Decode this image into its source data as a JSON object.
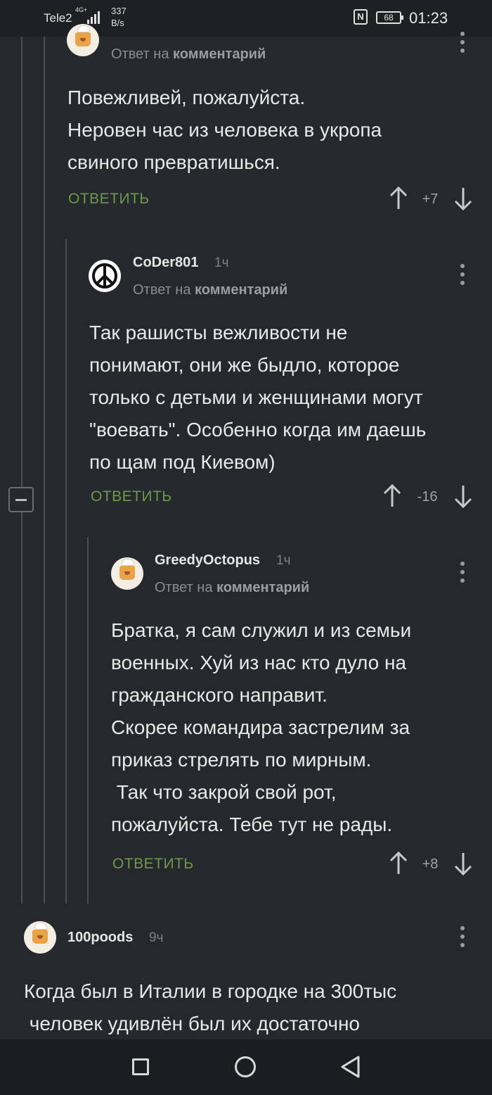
{
  "status_bar": {
    "carrier": "Tele2",
    "network": "4G+",
    "speed_value": "337",
    "speed_unit": "B/s",
    "nfc": "N",
    "battery": "68",
    "time": "01:23"
  },
  "comments": [
    {
      "username": "",
      "time": "",
      "reply_prefix": "Ответ на",
      "reply_target": "комментарий",
      "text": "Повежливей, пожалуйста.\nНеровен час из человека в укропа\nсвиного превратишься.",
      "reply_label": "ОТВЕТИТЬ",
      "score": "+7"
    },
    {
      "username": "CoDer801",
      "time": "1ч",
      "reply_prefix": "Ответ на",
      "reply_target": "комментарий",
      "text": "Так рашисты вежливости не\nпонимают, они же быдло, которое\nтолько с детьми и женщинами могут\n\"воевать\". Особенно когда им даешь\nпо щам под Киевом)",
      "reply_label": "ОТВЕТИТЬ",
      "score": "-16"
    },
    {
      "username": "GreedyOctopus",
      "time": "1ч",
      "reply_prefix": "Ответ на",
      "reply_target": "комментарий",
      "text": "Братка, я сам служил и из семьи\nвоенных. Хуй из нас кто дуло на\nгражданского направит.\nСкорее командира застрелим за\nприказ стрелять по мирным.\n Так что закрой свой рот,\nпожалуйста. Тебе тут не рады.",
      "reply_label": "ОТВЕТИТЬ",
      "score": "+8"
    },
    {
      "username": "100poods",
      "time": "9ч",
      "text": "Когда был в Италии в городке на 300тыс\n человек удивлён был их достаточно"
    }
  ],
  "icons": {
    "upvote": "arrow-up-icon",
    "downvote": "arrow-down-icon",
    "menu": "more-vert-icon",
    "collapse": "minus-icon",
    "nav_recents": "square-icon",
    "nav_home": "circle-icon",
    "nav_back": "triangle-back-icon"
  },
  "colors": {
    "background": "#25282c",
    "accent_green": "#6a9a4a",
    "thread_line": "#4a4d52"
  }
}
